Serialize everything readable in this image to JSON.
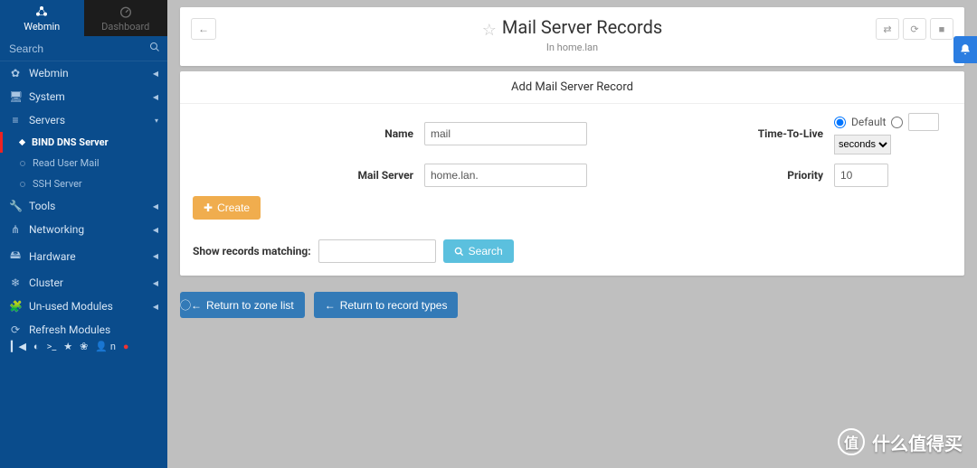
{
  "sidebar": {
    "tabs": {
      "webmin": "Webmin",
      "dashboard": "Dashboard"
    },
    "search_placeholder": "Search",
    "items": [
      {
        "icon": "⚙",
        "label": "Webmin"
      },
      {
        "icon": "🖥",
        "label": "System"
      },
      {
        "icon": "≡",
        "label": "Servers",
        "expanded": true,
        "children": [
          {
            "label": "BIND DNS Server",
            "active": true
          },
          {
            "label": "Read User Mail"
          },
          {
            "label": "SSH Server"
          }
        ]
      },
      {
        "icon": "🔧",
        "label": "Tools"
      },
      {
        "icon": "⋔",
        "label": "Networking"
      },
      {
        "icon": "🖴",
        "label": "Hardware"
      },
      {
        "icon": "❄",
        "label": "Cluster"
      },
      {
        "icon": "🧩",
        "label": "Un-used Modules"
      },
      {
        "icon": "⟳",
        "label": "Refresh Modules"
      }
    ],
    "bottom": {
      "user_label": "n"
    }
  },
  "header": {
    "title": "Mail Server Records",
    "subtitle": "In home.lan"
  },
  "form": {
    "section_title": "Add Mail Server Record",
    "name_label": "Name",
    "name_value": "mail",
    "ttl_label": "Time-To-Live",
    "ttl_default": "Default",
    "ttl_unit": "seconds",
    "mailserver_label": "Mail Server",
    "mailserver_value": "home.lan.",
    "priority_label": "Priority",
    "priority_value": "10",
    "create_label": "Create",
    "records_label": "Show records matching:",
    "records_value": "",
    "search_label": "Search"
  },
  "buttons": {
    "return_zone": "Return to zone list",
    "return_records": "Return to record types"
  },
  "watermark": "什么值得买"
}
